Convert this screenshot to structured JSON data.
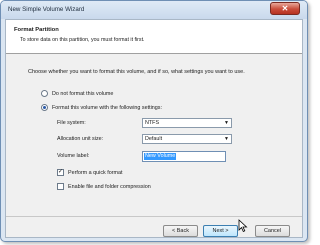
{
  "window": {
    "title": "New Simple Volume Wizard"
  },
  "header": {
    "title": "Format Partition",
    "subtitle": "To store data on this partition, you must format it first."
  },
  "question": "Choose whether you want to format this volume, and if so, what settings you want to use.",
  "options": {
    "no_format": "Do not format this volume",
    "format": "Format this volume with the following settings:"
  },
  "fields": {
    "file_system_label": "File system:",
    "file_system_value": "NTFS",
    "alloc_label": "Allocation unit size:",
    "alloc_value": "Default",
    "volume_label_label": "Volume label:",
    "volume_label_value": "New Volume"
  },
  "checks": {
    "quick_format": "Perform a quick format",
    "compression": "Enable file and folder compression"
  },
  "buttons": {
    "back": "< Back",
    "next": "Next >",
    "cancel": "Cancel"
  },
  "icons": {
    "close": "close-icon",
    "dropdown": "chevron-down-icon",
    "cursor": "mouse-pointer-icon"
  }
}
